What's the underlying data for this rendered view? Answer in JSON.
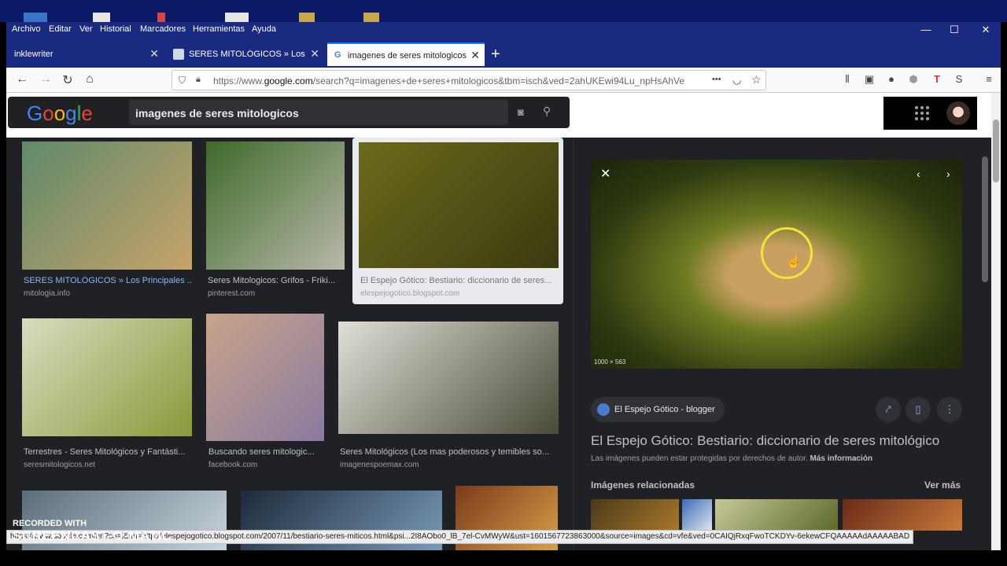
{
  "menubar": {
    "items": [
      "Archivo",
      "Editar",
      "Ver",
      "Historial",
      "Marcadores",
      "Herramientas",
      "Ayuda"
    ],
    "min": "—",
    "max": "☐",
    "close": "✕"
  },
  "tabs": [
    {
      "label": "inklewriter",
      "close": "✕"
    },
    {
      "label": "SERES MITOLÓGICOS » Los Principales",
      "close": "✕"
    },
    {
      "label": "imagenes de seres mitologicos",
      "close": "✕"
    }
  ],
  "new_tab": "+",
  "navbar": {
    "back": "←",
    "forward": "→",
    "reload": "↻",
    "home": "⌂",
    "url_prefix": "https://www.",
    "url_domain": "google.com",
    "url_rest": "/search?q=imagenes+de+seres+mitologicos&tbm=isch&ved=2ahUKEwi94Lu_npHsAhVe",
    "more": "•••"
  },
  "google": {
    "logo": [
      "G",
      "o",
      "o",
      "g",
      "l",
      "e"
    ],
    "logo_colors": [
      "#4285f4",
      "#ea4335",
      "#fbbc05",
      "#4285f4",
      "#34a853",
      "#ea4335"
    ],
    "query": "imagenes de seres mitologicos",
    "camera_icon": "camera-icon",
    "search_icon": "search-icon"
  },
  "results": [
    {
      "title": "SERES MITOLÓGICOS » Los Principales ...",
      "source": "mitologia.info",
      "title_color": "#8ab4f8",
      "c1": "#5f8a6a",
      "c2": "#c7a36a"
    },
    {
      "title": "Seres Mitologicos: Grifos - Friki...",
      "source": "pinterest.com",
      "title_color": "#bdc1c6",
      "c1": "#3e6a2a",
      "c2": "#b8b8a8"
    },
    {
      "title": "El Espejo Gótico: Bestiario: diccionario de seres...",
      "source": "elespejogotico.blogspot.com",
      "title_color": "#777",
      "c1": "#6b6b1c",
      "c2": "#3a3a10"
    },
    {
      "title": "Terrestres - Seres Mitológicos y Fantásti...",
      "source": "seresmitologicos.net",
      "title_color": "#bdc1c6",
      "c1": "#d8dcc0",
      "c2": "#8a9a3a"
    },
    {
      "title": "Buscando seres mitologic...",
      "source": "facebook.com",
      "title_color": "#bdc1c6",
      "c1": "#c9a48a",
      "c2": "#8a7aa0"
    },
    {
      "title": "Seres Mitológicos (Los mas poderosos y temibles so...",
      "source": "imagenespoemax.com",
      "title_color": "#bdc1c6",
      "c1": "#e0e0d8",
      "c2": "#4a4a3a"
    }
  ],
  "panel": {
    "resolution": "1000 × 563",
    "site": "El Espejo Gótico - blogger",
    "title": "El Espejo Gótico: Bestiario: diccionario de seres mitológico",
    "copyright": "Las imágenes pueden estar protegidas por derechos de autor.",
    "more_info": "Más información",
    "related": "Imágenes relacionadas",
    "see_more": "Ver más"
  },
  "status_url": "https://www.google.com/url?sa=i&url=http://elespejogotico.blogspot.com/2007/11/bestiario-seres-miticos.html&psi...2I8AObo0_lB_7el-CvMWyW&ust=1601567723863000&source=images&cd=vfe&ved=0CAIQjRxqFwoTCKDYv-6ekewCFQAAAAAdAAAAABAD",
  "watermark": {
    "line1": "RECORDED WITH",
    "line2": "SCREENCAST-O-MATIC"
  }
}
